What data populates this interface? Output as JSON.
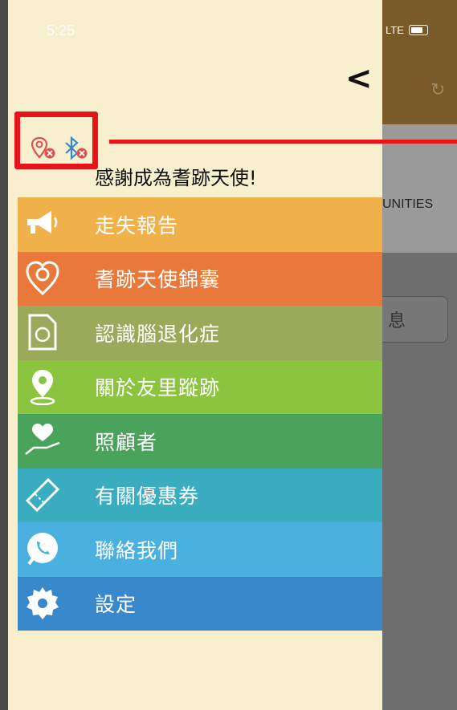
{
  "status_bar": {
    "time": "5:25",
    "network": "LTE"
  },
  "drawer": {
    "greeting": "感謝成為耆跡天使!",
    "status_icons": [
      "location-off-icon",
      "bluetooth-off-icon"
    ],
    "menu": [
      {
        "label": "走失報告",
        "icon": "megaphone-icon",
        "color": "#f0b14a"
      },
      {
        "label": "耆跡天使錦囊",
        "icon": "heart-location-icon",
        "color": "#e8793a"
      },
      {
        "label": "認識腦退化症",
        "icon": "brain-document-icon",
        "color": "#9aaa5a"
      },
      {
        "label": "關於友里蹤跡",
        "icon": "map-pin-icon",
        "color": "#8bc53f"
      },
      {
        "label": "照顧者",
        "icon": "caring-hand-icon",
        "color": "#4aa35a"
      },
      {
        "label": "有關優惠券",
        "icon": "coupon-icon",
        "color": "#3aaec0"
      },
      {
        "label": "聯絡我們",
        "icon": "phone-bubble-icon",
        "color": "#4ab0e0"
      },
      {
        "label": "設定",
        "icon": "gear-icon",
        "color": "#3a88cc"
      }
    ]
  },
  "background": {
    "partial_text": "UNITIES",
    "partial_button": "息"
  }
}
